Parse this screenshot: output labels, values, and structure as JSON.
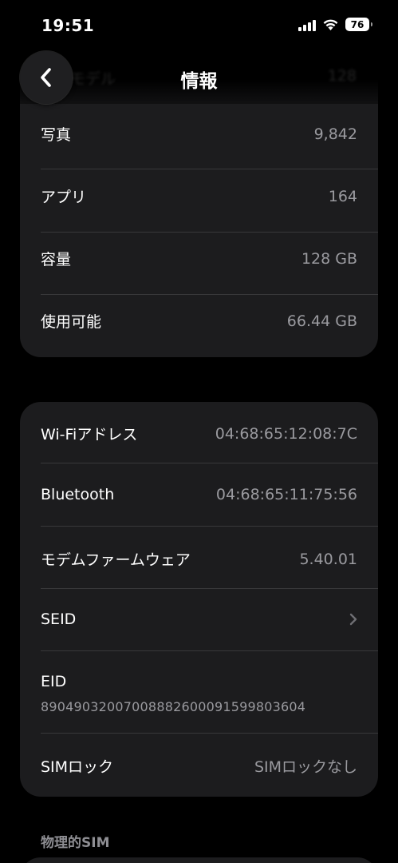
{
  "status_bar": {
    "time": "19:51",
    "battery": "76",
    "icons": [
      "signal-icon",
      "wifi-icon",
      "battery-icon"
    ]
  },
  "nav": {
    "title": "情報",
    "back_icon": "chevron-left-icon",
    "obscured_label": "モデル",
    "obscured_value": "128"
  },
  "storage_rows": [
    {
      "label": "写真",
      "value": "9,842"
    },
    {
      "label": "アプリ",
      "value": "164"
    },
    {
      "label": "容量",
      "value": "128 GB"
    },
    {
      "label": "使用可能",
      "value": "66.44 GB"
    }
  ],
  "network_rows": [
    {
      "label": "Wi-Fiアドレス",
      "value": "04:68:65:12:08:7C"
    },
    {
      "label": "Bluetooth",
      "value": "04:68:65:11:75:56"
    },
    {
      "label": "モデムファームウェア",
      "value": "5.40.01"
    },
    {
      "label": "SEID",
      "value": ""
    }
  ],
  "eid": {
    "label": "EID",
    "value": "89049032007008882600091599803604"
  },
  "sim_lock": {
    "label": "SIMロック",
    "value": "SIMロックなし"
  },
  "physical_sim_header": "物理的SIM",
  "colors": {
    "background": "#000000",
    "card": "#1c1c1e",
    "secondary_text": "#9a9a9f",
    "separator": "#38383a"
  }
}
